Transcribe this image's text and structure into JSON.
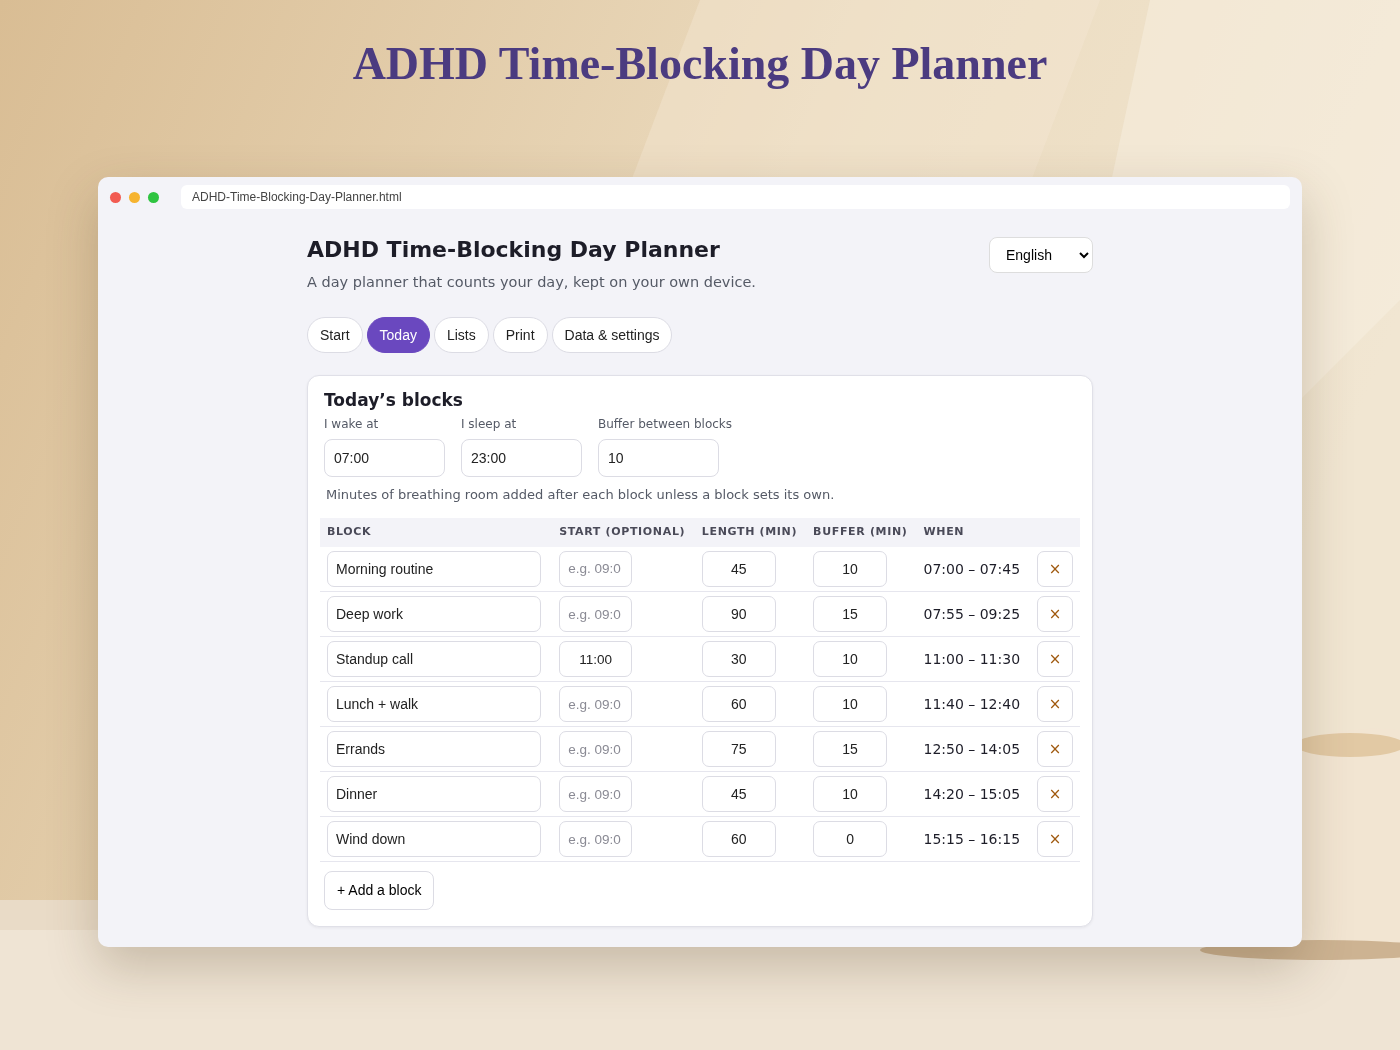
{
  "headline": "ADHD Time-Blocking Day Planner",
  "browser": {
    "address": "ADHD-Time-Blocking-Day-Planner.html"
  },
  "app": {
    "title": "ADHD Time-Blocking Day Planner",
    "subtitle": "A day planner that counts your day, kept on your own device.",
    "language": "English",
    "tabs": [
      {
        "label": "Start",
        "selected": false
      },
      {
        "label": "Today",
        "selected": true
      },
      {
        "label": "Lists",
        "selected": false
      },
      {
        "label": "Print",
        "selected": false
      },
      {
        "label": "Data & settings",
        "selected": false
      }
    ]
  },
  "section": {
    "title": "Today’s blocks",
    "fields": [
      {
        "label": "I wake at",
        "value": "07:00"
      },
      {
        "label": "I sleep at",
        "value": "23:00"
      },
      {
        "label": "Buffer between blocks",
        "value": "10"
      }
    ],
    "hint": "Minutes of breathing room added after each block unless a block sets its own.",
    "table": {
      "columns": [
        "BLOCK",
        "START (OPTIONAL)",
        "LENGTH (MIN)",
        "BUFFER (MIN)",
        "WHEN"
      ],
      "rows": [
        {
          "block": "Morning routine",
          "start": {
            "placeholder": "e.g. 09:0"
          },
          "length": "45",
          "buffer": "10",
          "when": "07:00 – 07:45",
          "remove": "×"
        },
        {
          "block": "Deep work",
          "start": {
            "placeholder": "e.g. 09:0"
          },
          "length": "90",
          "buffer": "15",
          "when": "07:55 – 09:25",
          "remove": "×"
        },
        {
          "block": "Standup call",
          "start": {
            "value": "11:00"
          },
          "length": "30",
          "buffer": "10",
          "when": "11:00 – 11:30",
          "remove": "×"
        },
        {
          "block": "Lunch + walk",
          "start": {
            "placeholder": "e.g. 09:0"
          },
          "length": "60",
          "buffer": "10",
          "when": "11:40 – 12:40",
          "remove": "×"
        },
        {
          "block": "Errands",
          "start": {
            "placeholder": "e.g. 09:0"
          },
          "length": "75",
          "buffer": "15",
          "when": "12:50 – 14:05",
          "remove": "×"
        },
        {
          "block": "Dinner",
          "start": {
            "placeholder": "e.g. 09:0"
          },
          "length": "45",
          "buffer": "10",
          "when": "14:20 – 15:05",
          "remove": "×"
        },
        {
          "block": "Wind down",
          "start": {
            "placeholder": "e.g. 09:0"
          },
          "length": "60",
          "buffer": "0",
          "when": "15:15 – 16:15",
          "remove": "×"
        }
      ]
    },
    "add_button": "+ Add a block"
  }
}
